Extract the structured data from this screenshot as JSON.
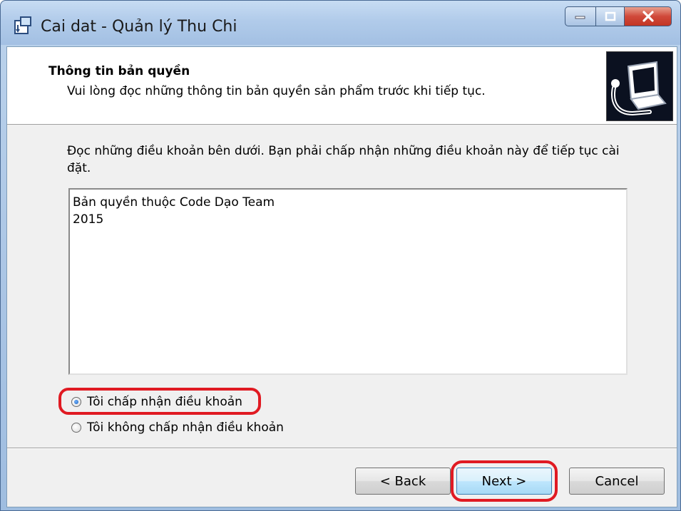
{
  "window": {
    "title": "Cai dat - Quản lý Thu Chi",
    "icon": "installer-icon",
    "caption_buttons": [
      "minimize-icon",
      "maximize-icon",
      "close-icon"
    ]
  },
  "header": {
    "title": "Thông tin bản quyền",
    "subtitle": "Vui lòng đọc những thông tin bản quyền sản phẩm trước khi tiếp tục.",
    "image": "computer-install-icon"
  },
  "body": {
    "instruction": "Đọc những điều khoản bên dưới. Bạn phải chấp nhận những điều khoản này để tiếp tục cài đặt.",
    "license_text": "Bản quyền thuộc Code Dạo Team\n2015"
  },
  "options": {
    "accept_label": "Tôi chấp nhận điều khoản",
    "decline_label": "Tôi không chấp nhận điều khoản",
    "selected": "accept"
  },
  "buttons": {
    "back": "< Back",
    "next": "Next >",
    "cancel": "Cancel"
  },
  "colors": {
    "highlight": "#e01a22",
    "titlebar": "#b1cbea",
    "dialog_bg": "#f0f0f0"
  }
}
